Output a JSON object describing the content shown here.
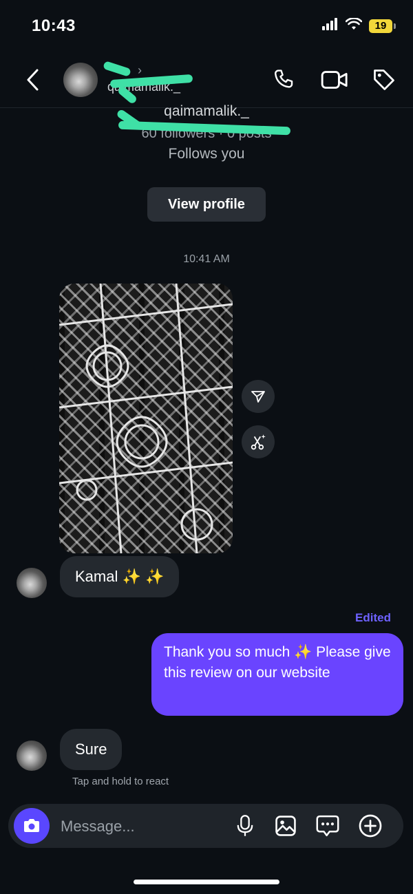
{
  "status_bar": {
    "time": "10:43",
    "battery": "19"
  },
  "header": {
    "username": "qaimamalik._"
  },
  "profile": {
    "username": "qaimamalik._",
    "stats": "60 followers · 0 posts",
    "follows_you": "Follows you",
    "view_profile": "View profile"
  },
  "messages": {
    "timestamp": "10:41 AM",
    "received_1": "Kamal ✨ ✨",
    "edited_label": "Edited",
    "sent_1": "Thank you  so much ✨ Please give this review on our website",
    "received_2": "Sure",
    "hint": "Tap and hold to react"
  },
  "composer": {
    "placeholder": "Message..."
  },
  "colors": {
    "accent": "#6a44ff",
    "camera": "#5a47ff",
    "edited": "#6e62ff",
    "background": "#0b0f14"
  }
}
